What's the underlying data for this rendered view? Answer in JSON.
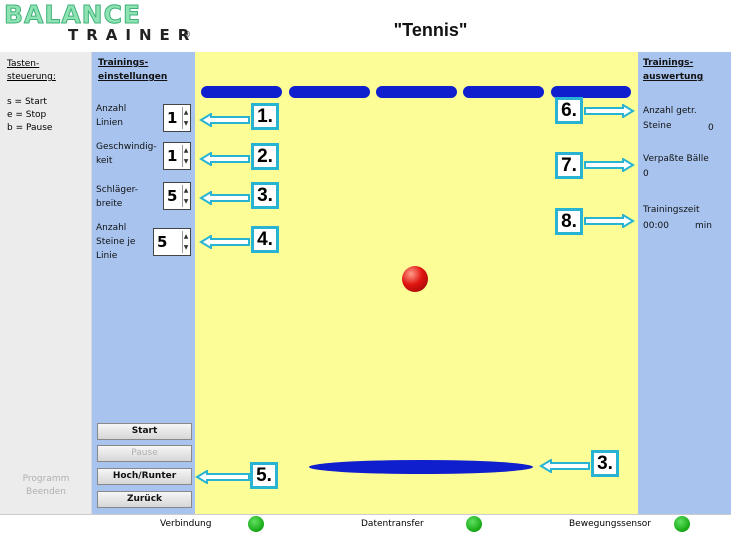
{
  "header": {
    "logo_top": "BALANCE",
    "logo_bottom": "TRAINER",
    "logo_reg": "®",
    "title": "\"Tennis\""
  },
  "keys": {
    "title_line1": "Tasten-",
    "title_line2": "steuerung:",
    "items": [
      "s = Start",
      "e = Stop",
      "b = Pause"
    ],
    "program_end_line1": "Programm",
    "program_end_line2": "Beenden"
  },
  "settings": {
    "title_line1": "Trainings-",
    "title_line2": "einstellungen",
    "lines": {
      "label1": "Anzahl",
      "label2": "Linien",
      "value": "1"
    },
    "speed": {
      "label1": "Geschwindig-",
      "label2": "keit",
      "value": "1"
    },
    "paddle": {
      "label1": "Schläger-",
      "label2": "breite",
      "value": "5"
    },
    "stones": {
      "label1": "Anzahl",
      "label2": "Steine je",
      "label3": "Linie",
      "value": "5"
    },
    "spin_up": "▲",
    "spin_down": "▼"
  },
  "buttons": {
    "start": "Start",
    "pause": "Pause",
    "up_down": "Hoch/Runter",
    "back": "Zurück"
  },
  "evaluation": {
    "title_line1": "Trainings-",
    "title_line2": "auswertung",
    "hits_label1": "Anzahl getr.",
    "hits_label2": "Steine",
    "hits_value": "0",
    "missed_label": "Verpaßte Bälle",
    "missed_value": "0",
    "time_label": "Trainingszeit",
    "time_value": "00:00",
    "time_unit": "min"
  },
  "callouts": [
    "1.",
    "2.",
    "3.",
    "4.",
    "5.",
    "6.",
    "7.",
    "8.",
    "3."
  ],
  "status": {
    "connection": "Verbindung",
    "transfer": "Datentransfer",
    "sensor": "Bewegungssensor"
  },
  "colors": {
    "game_background": "#fdfd97",
    "panel_blue": "#a7c3ee",
    "brick_blue": "#0f1fce",
    "callout_cyan": "#28b3d3",
    "led_green": "#14a814"
  }
}
